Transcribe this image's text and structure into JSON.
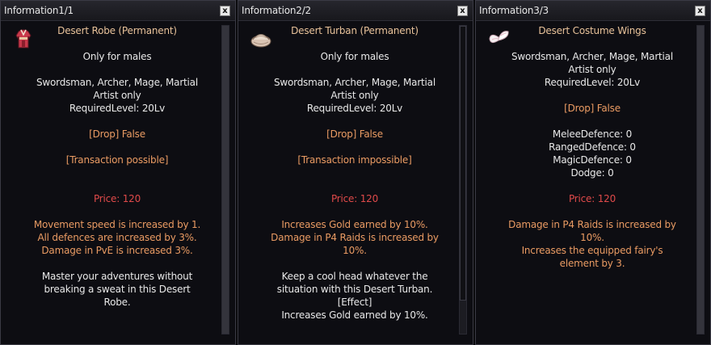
{
  "panels": [
    {
      "title": "Information1/1",
      "close": "x",
      "item_name": "Desert Robe (Permanent)",
      "gender": "Only for males",
      "classes": [
        "Swordsman, Archer, Mage, Martial",
        "Artist only"
      ],
      "level": "RequiredLevel: 20Lv",
      "drop": "[Drop] False",
      "transaction": "[Transaction possible]",
      "price": "Price: 120",
      "effects": [
        "Movement speed is increased by 1.",
        "All defences are increased by 3%.",
        "Damage in PvE is increased 3%."
      ],
      "description": [
        "Master your adventures without",
        "breaking a sweat in this Desert",
        "Robe."
      ]
    },
    {
      "title": "Information2/2",
      "close": "x",
      "item_name": "Desert Turban (Permanent)",
      "gender": "Only for males",
      "classes": [
        "Swordsman, Archer, Mage, Martial",
        "Artist only"
      ],
      "level": "RequiredLevel: 20Lv",
      "drop": "[Drop] False",
      "transaction": "[Transaction impossible]",
      "price": "Price: 120",
      "effects": [
        "Increases Gold earned by 10%.",
        "Damage in P4 Raids is increased by",
        "10%."
      ],
      "description": [
        "Keep a cool head whatever the",
        "situation with this Desert Turban.",
        "[Effect]",
        "Increases Gold earned by 10%."
      ]
    },
    {
      "title": "Information3/3",
      "close": "x",
      "item_name": "Desert Costume Wings",
      "classes": [
        "Swordsman, Archer, Mage, Martial",
        "Artist only"
      ],
      "level": "RequiredLevel: 20Lv",
      "drop": "[Drop] False",
      "stats": [
        "MeleeDefence: 0",
        "RangedDefence: 0",
        "MagicDefence: 0",
        "Dodge: 0"
      ],
      "price": "Price: 120",
      "effects": [
        "Damage in P4 Raids is increased by",
        "10%.",
        "Increases the equipped fairy's",
        "element by 3."
      ]
    }
  ],
  "colors": {
    "item_name": "#e8c29a",
    "text": "#e8e8e8",
    "transaction": "#ea9b63",
    "price": "#e04a4a",
    "effect": "#ea9b63"
  },
  "icons": [
    "robe-icon",
    "turban-icon",
    "wings-icon"
  ]
}
